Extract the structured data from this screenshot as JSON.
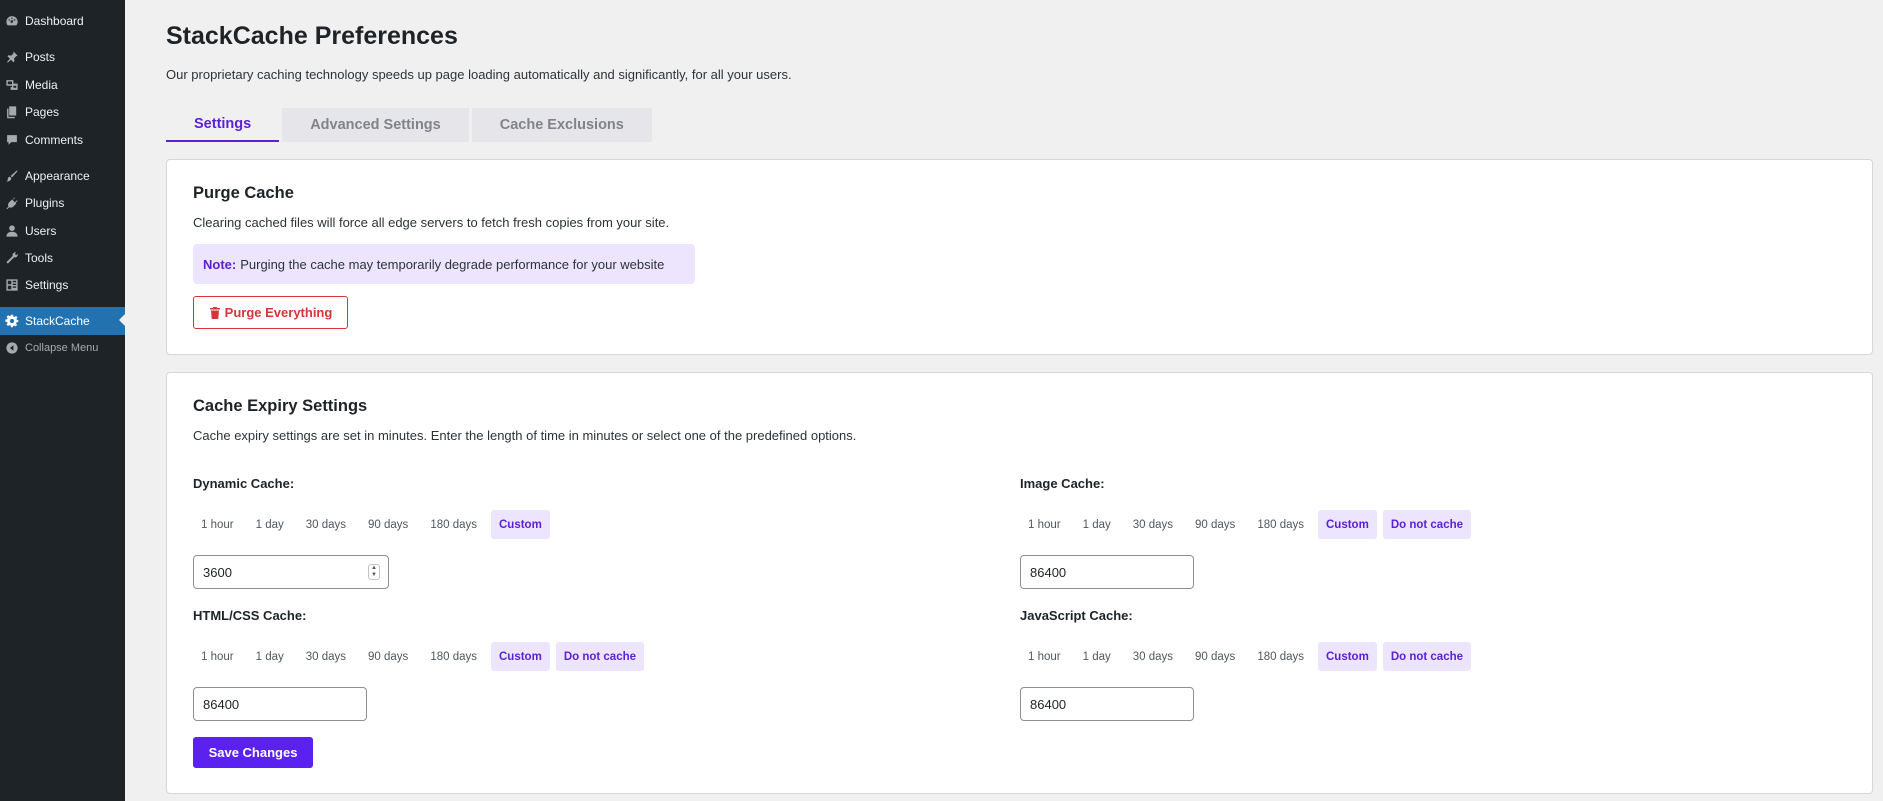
{
  "sidebar": {
    "items": [
      {
        "label": "Dashboard",
        "icon": "dashboard-icon"
      },
      {
        "label": "Posts",
        "icon": "pin-icon"
      },
      {
        "label": "Media",
        "icon": "media-icon"
      },
      {
        "label": "Pages",
        "icon": "pages-icon"
      },
      {
        "label": "Comments",
        "icon": "comment-icon"
      },
      {
        "label": "Appearance",
        "icon": "brush-icon"
      },
      {
        "label": "Plugins",
        "icon": "plugin-icon"
      },
      {
        "label": "Users",
        "icon": "user-icon"
      },
      {
        "label": "Tools",
        "icon": "wrench-icon"
      },
      {
        "label": "Settings",
        "icon": "settings-icon"
      },
      {
        "label": "StackCache",
        "icon": "gear-icon"
      },
      {
        "label": "Collapse Menu",
        "icon": "collapse-icon"
      }
    ],
    "active_color": "#2271b1"
  },
  "page": {
    "title": "StackCache Preferences",
    "description": "Our proprietary caching technology speeds up page loading automatically and significantly, for all your users."
  },
  "tabs": [
    {
      "label": "Settings",
      "active": true
    },
    {
      "label": "Advanced Settings",
      "active": false
    },
    {
      "label": "Cache Exclusions",
      "active": false
    }
  ],
  "purge": {
    "title": "Purge Cache",
    "description": "Clearing cached files will force all edge servers to fetch fresh copies from your site.",
    "note_label": "Note:",
    "note_text": "Purging the cache may temporarily degrade performance for your website",
    "button_label": "Purge Everything"
  },
  "expiry": {
    "title": "Cache Expiry Settings",
    "description": "Cache expiry settings are set in minutes. Enter the length of time in minutes or select one of the predefined options.",
    "option_labels": [
      "1 hour",
      "1 day",
      "30 days",
      "90 days",
      "180 days",
      "Custom",
      "Do not cache"
    ],
    "dynamic": {
      "label": "Dynamic Cache:",
      "value": "3600",
      "selected": "Custom"
    },
    "image": {
      "label": "Image Cache:",
      "value": "86400",
      "selected": "Custom"
    },
    "htmlcss": {
      "label": "HTML/CSS Cache:",
      "value": "86400",
      "selected": "Custom"
    },
    "javascript": {
      "label": "JavaScript Cache:",
      "value": "86400",
      "selected": "Custom"
    },
    "save_label": "Save Changes"
  },
  "colors": {
    "accent": "#5b21f0",
    "danger": "#d63638",
    "note_bg": "#ede5fe"
  }
}
